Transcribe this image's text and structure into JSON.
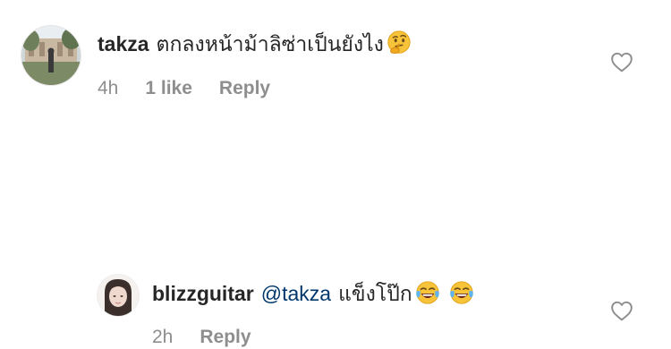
{
  "comments": [
    {
      "username": "takza",
      "text": "ตกลงหน้าม้าลิซ่าเป็นยังไง",
      "emoji": "thinking-face",
      "time": "4h",
      "likes": "1 like",
      "reply_label": "Reply"
    },
    {
      "username": "blizzguitar",
      "mention": "@takza",
      "text": "แข็งโป๊ก",
      "emoji": "face-with-tears-of-joy",
      "emoji_count": 2,
      "time": "2h",
      "reply_label": "Reply"
    }
  ],
  "colors": {
    "text": "#262626",
    "meta": "#8e8e8e",
    "mention": "#00376b",
    "heart_outline": "#8e8e8e"
  },
  "icons": [
    "heart-outline-icon",
    "thinking-face-emoji",
    "face-with-tears-of-joy-emoji"
  ]
}
